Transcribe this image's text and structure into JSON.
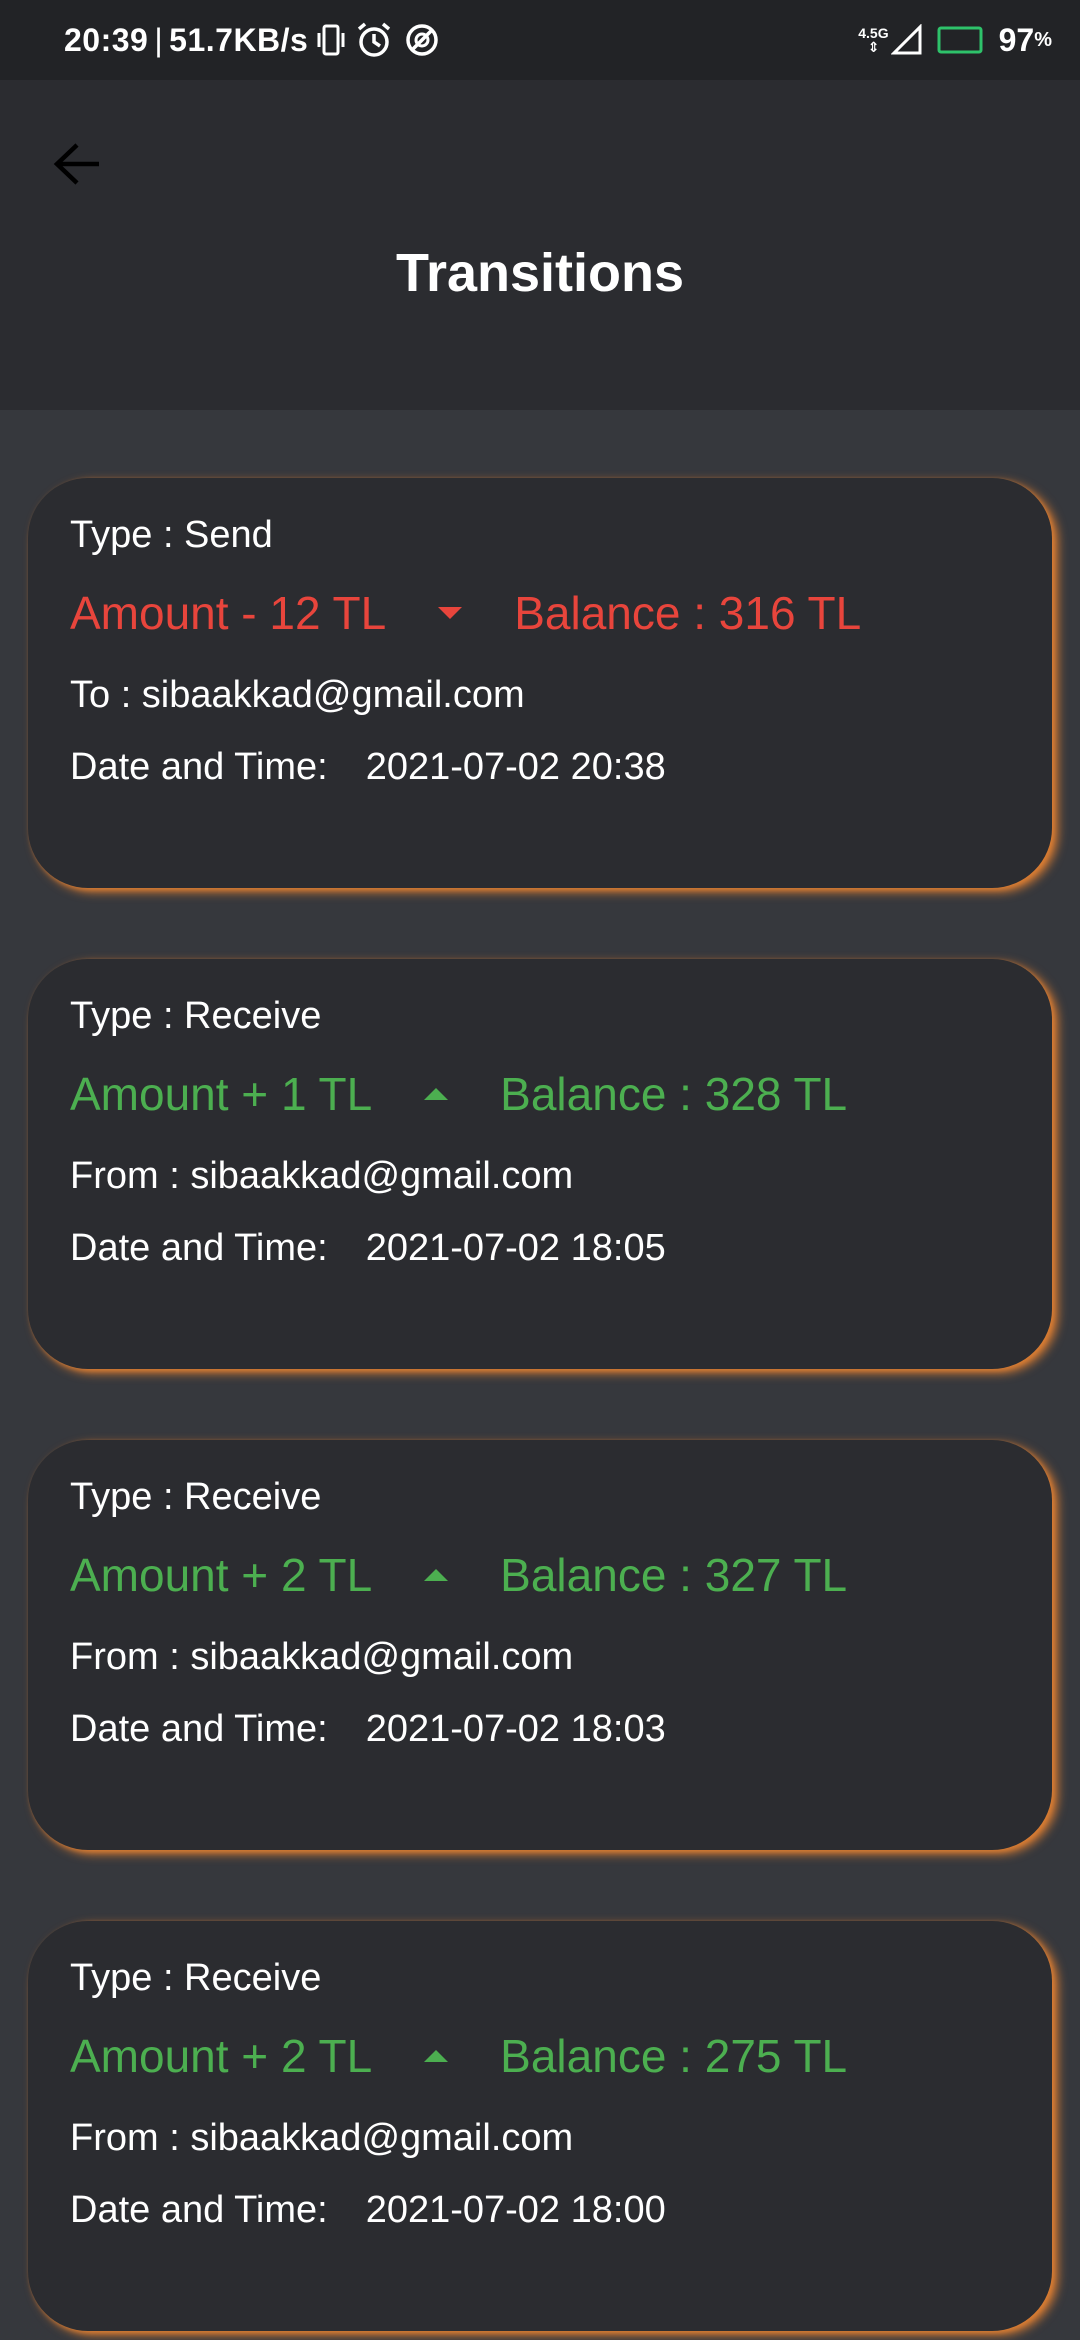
{
  "status_bar": {
    "time": "20:39",
    "separator": "|",
    "speed": "51.7KB/s",
    "network": "4.5G",
    "battery_percent": "97",
    "battery_unit": "%"
  },
  "header": {
    "title": "Transitions"
  },
  "colors": {
    "send": "#e8453c",
    "receive": "#4caf50",
    "card_glow": "#e6823c"
  },
  "transactions": [
    {
      "type_label": "Type : Send",
      "amount_label": "Amount - 12 TL",
      "direction": "down",
      "balance_label": "Balance : 316 TL",
      "party_label": "To : sibaakkad@gmail.com",
      "date_label": "Date and Time:",
      "date_value": "2021-07-02 20:38"
    },
    {
      "type_label": "Type : Receive",
      "amount_label": "Amount + 1 TL",
      "direction": "up",
      "balance_label": "Balance : 328 TL",
      "party_label": "From : sibaakkad@gmail.com",
      "date_label": "Date and Time:",
      "date_value": "2021-07-02 18:05"
    },
    {
      "type_label": "Type : Receive",
      "amount_label": "Amount + 2 TL",
      "direction": "up",
      "balance_label": "Balance : 327 TL",
      "party_label": "From : sibaakkad@gmail.com",
      "date_label": "Date and Time:",
      "date_value": "2021-07-02 18:03"
    },
    {
      "type_label": "Type : Receive",
      "amount_label": "Amount + 2 TL",
      "direction": "up",
      "balance_label": "Balance : 275 TL",
      "party_label": "From : sibaakkad@gmail.com",
      "date_label": "Date and Time:",
      "date_value": "2021-07-02 18:00"
    }
  ]
}
